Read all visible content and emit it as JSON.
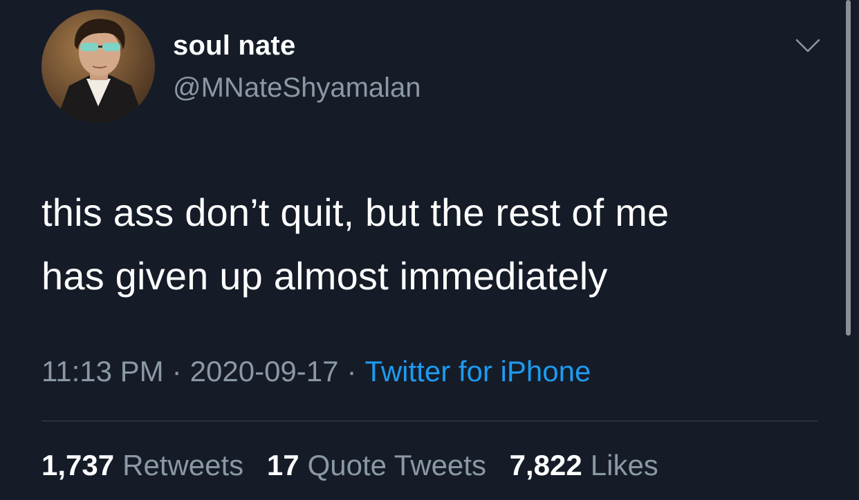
{
  "user": {
    "display_name": "soul nate",
    "handle": "@MNateShyamalan",
    "avatar_icon": "portrait-avatar"
  },
  "menu": {
    "icon": "chevron-down-icon"
  },
  "tweet": {
    "lines": [
      "this ass don’t quit, but the rest of me",
      "has given up almost immediately"
    ]
  },
  "meta": {
    "time": "11:13 PM",
    "date": "2020-09-17",
    "separator": "·",
    "source": "Twitter for iPhone"
  },
  "stats": {
    "retweets": {
      "count": "1,737",
      "label": "Retweets"
    },
    "quotes": {
      "count": "17",
      "label": "Quote Tweets"
    },
    "likes": {
      "count": "7,822",
      "label": "Likes"
    }
  },
  "colors": {
    "background": "#151c28",
    "primary_text": "#ffffff",
    "secondary_text": "#8b98a5",
    "link": "#1d9bf0",
    "divider": "#38444d"
  }
}
